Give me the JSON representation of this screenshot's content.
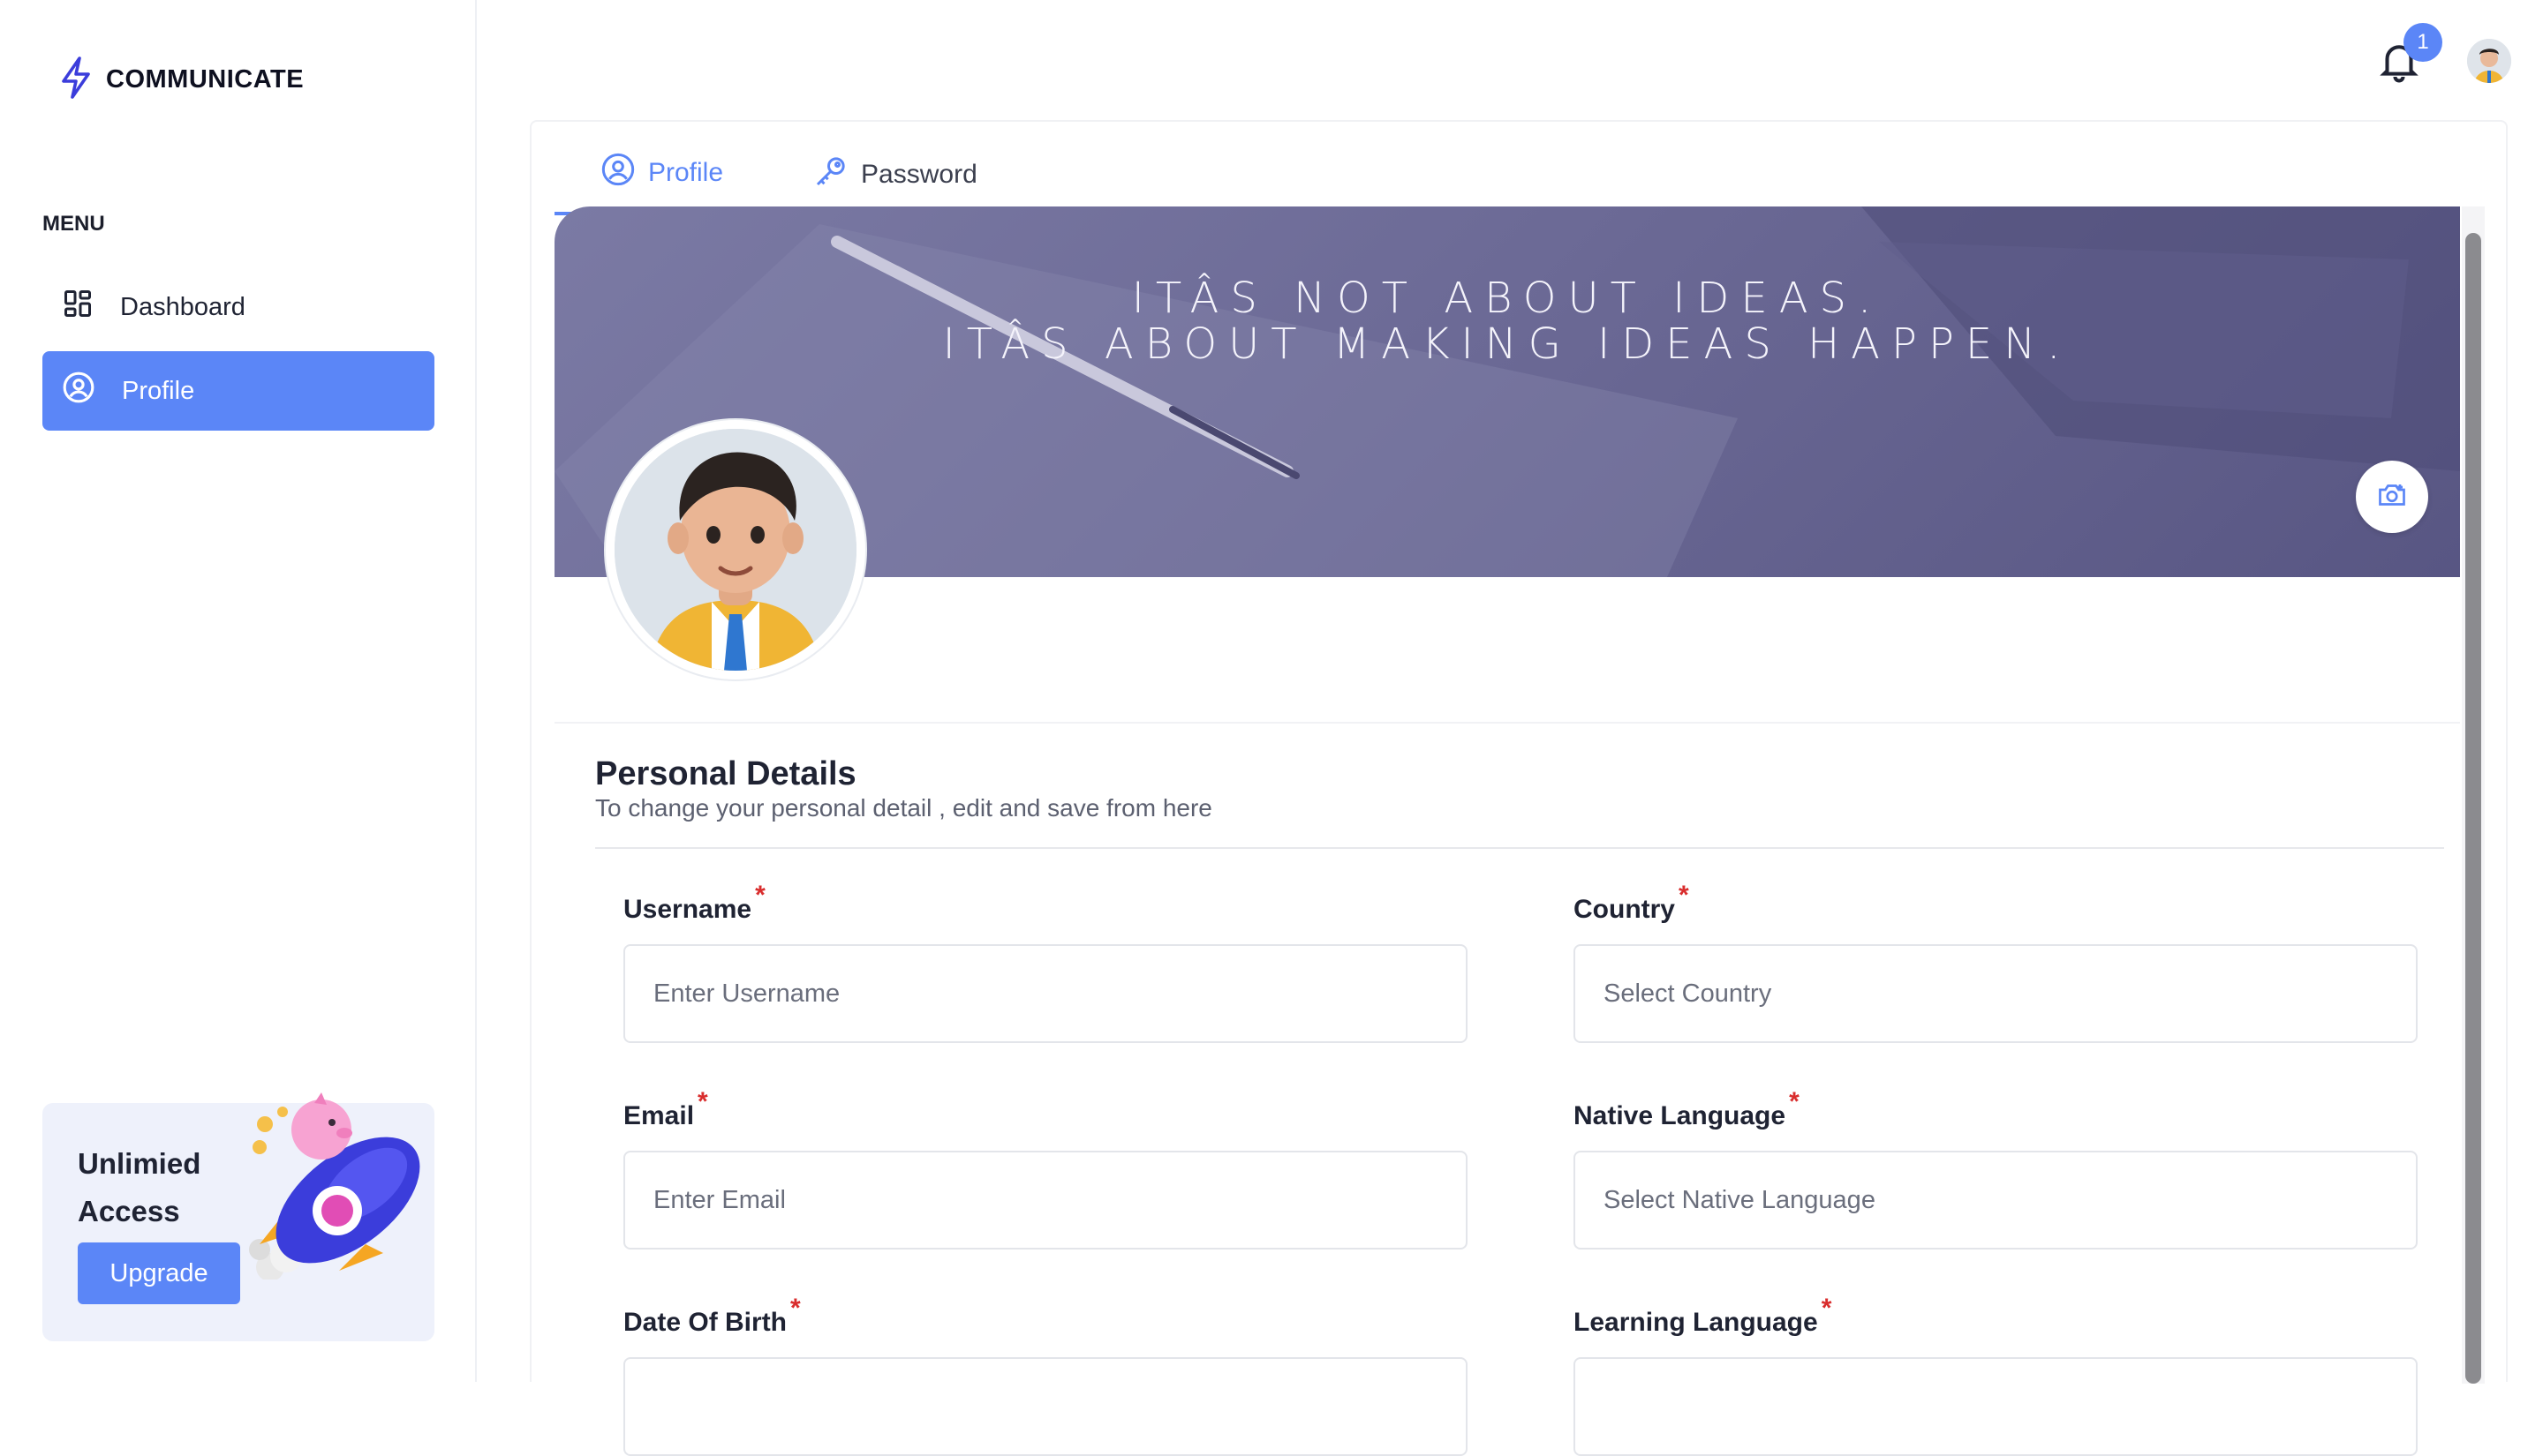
{
  "brand": {
    "name": "COMMUNICATE"
  },
  "sidebar": {
    "menu_heading": "MENU",
    "items": [
      {
        "label": "Dashboard",
        "icon": "dashboard-grid-icon",
        "active": false
      },
      {
        "label": "Profile",
        "icon": "user-circle-icon",
        "active": true
      }
    ],
    "upgrade": {
      "title": "Unlimied Access",
      "button": "Upgrade"
    }
  },
  "topbar": {
    "notification_count": "1"
  },
  "tabs": [
    {
      "label": "Profile",
      "icon": "user-circle-icon",
      "active": true
    },
    {
      "label": "Password",
      "icon": "key-icon",
      "active": false
    }
  ],
  "banner": {
    "quote_line1": "ITÂS NOT ABOUT IDEAS.",
    "quote_line2": "ITÂS ABOUT MAKING IDEAS HAPPEN."
  },
  "personal_details": {
    "title": "Personal Details",
    "subtitle": "To change your personal detail , edit and save from here",
    "fields": {
      "username": {
        "label": "Username",
        "placeholder": "Enter Username",
        "required": true
      },
      "country": {
        "label": "Country",
        "placeholder": "Select Country",
        "required": true
      },
      "email": {
        "label": "Email",
        "placeholder": "Enter Email",
        "required": true
      },
      "native_language": {
        "label": "Native Language",
        "placeholder": "Select Native Language",
        "required": true
      },
      "date_of_birth": {
        "label": "Date Of Birth",
        "required": true
      },
      "learning_language": {
        "label": "Learning Language",
        "required": true
      }
    }
  },
  "colors": {
    "accent": "#5b86f7",
    "required": "#d92d2d",
    "brand_icon": "#3b3ddb"
  }
}
